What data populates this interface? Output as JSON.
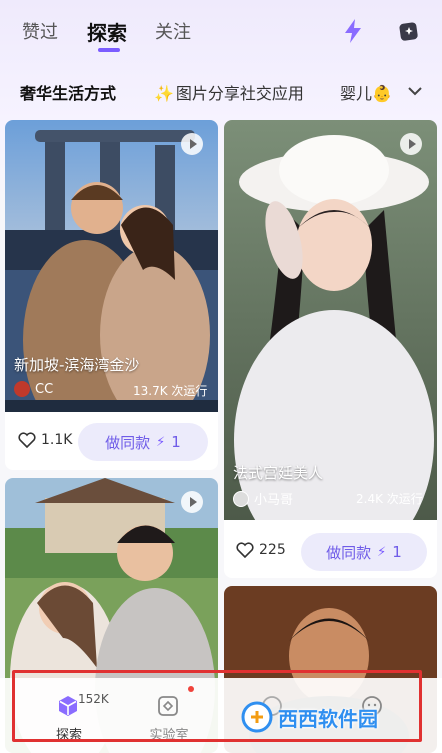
{
  "header": {
    "tabs": [
      {
        "label": "赞过"
      },
      {
        "label": "探索"
      },
      {
        "label": "关注"
      }
    ],
    "active_tab": "探索",
    "icons": [
      "lightning-icon",
      "sparkle-card-icon"
    ]
  },
  "categories": [
    {
      "label": "奢华生活方式"
    },
    {
      "label": "图片分享社交应用",
      "prefix_icon": "sparkle-icon"
    },
    {
      "label": "婴儿👶"
    }
  ],
  "cards": [
    {
      "title": "新加坡-滨海湾金沙",
      "author": "CC",
      "runs": "13.7K 次运行",
      "likes": "1.1K",
      "button_label": "做同款",
      "cost": "1"
    },
    {
      "title": "法式宫廷美人",
      "author": "小马哥",
      "runs": "2.4K 次运行",
      "likes": "225",
      "button_label": "做同款",
      "cost": "1"
    },
    {
      "title": "",
      "author": "",
      "runs": ""
    },
    {
      "title": "",
      "author": "",
      "runs": ""
    }
  ],
  "bottom_nav": {
    "items": [
      {
        "label": "探索",
        "badge": "152K"
      },
      {
        "label": "实验室"
      }
    ]
  },
  "watermark": {
    "text": "西西软件园"
  },
  "colors": {
    "accent": "#7b5cff",
    "button_bg": "#ecebfb",
    "highlight_box": "#e03131"
  }
}
